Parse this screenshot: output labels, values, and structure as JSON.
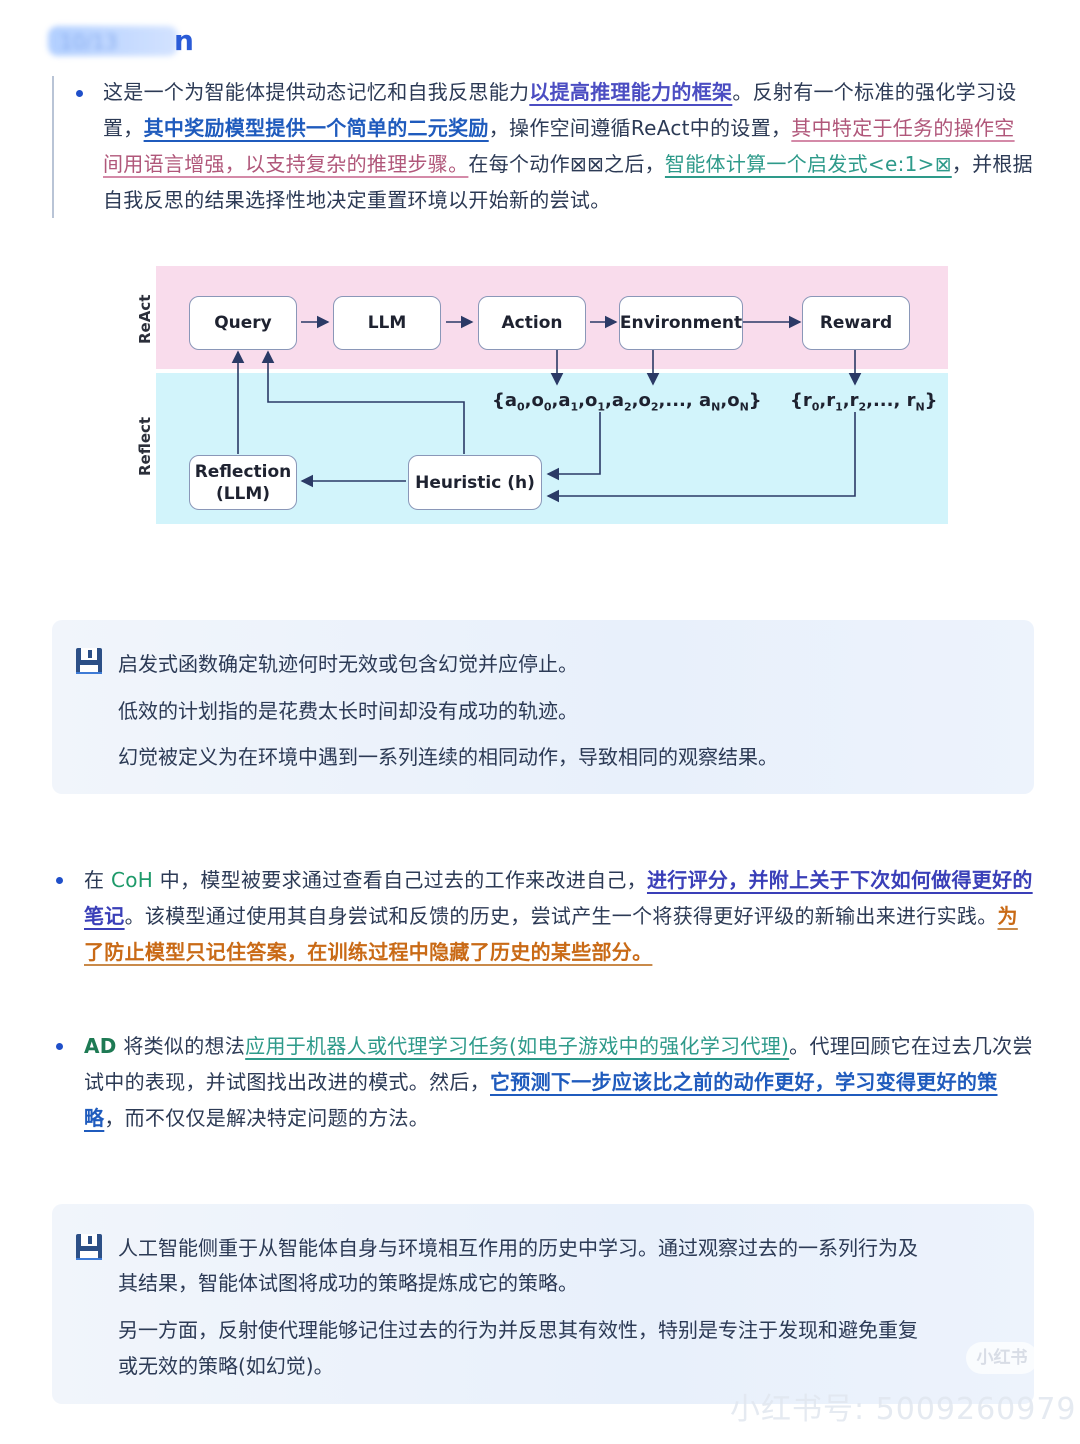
{
  "header": {
    "blurred_badge": "10/13",
    "title_fragment": "n"
  },
  "section1": {
    "segments": [
      {
        "t": "这是一个为智能体提供动态记忆和自我反思能力",
        "s": ""
      },
      {
        "t": "以提高推理能力的框架",
        "s": "u-purple"
      },
      {
        "t": "。反射有一个标准的强化学习设置，",
        "s": ""
      },
      {
        "t": "其中奖励模型提供一个简单的二元奖励",
        "s": "u-blue"
      },
      {
        "t": "，操作空间遵循ReAct中的设置，",
        "s": ""
      },
      {
        "t": "其中特定于任务的操作空间用语言增强，以支持复杂的推理步骤。",
        "s": "u-pink"
      },
      {
        "t": "在每个动作⊠⊠之后，",
        "s": ""
      },
      {
        "t": "智能体计算一个启发式<e:1>⊠",
        "s": "u-teal"
      },
      {
        "t": "，并根据自我反思的结果选择性地决定重置环境以开始新的尝试。",
        "s": ""
      }
    ]
  },
  "diagram": {
    "lanes": {
      "react": "ReAct",
      "reflect": "Reflect"
    },
    "nodes": {
      "query": "Query",
      "llm": "LLM",
      "action": "Action",
      "environment": "Environment",
      "reward": "Reward",
      "reflection_line1": "Reflection",
      "reflection_line2": "(LLM)",
      "heuristic": "Heuristic (h)"
    },
    "trajectory_seq": "{a0,o0,a1,o1,a2,o2,..., aN,oN}",
    "reward_seq": "{r0,r1,r2,..., rN}"
  },
  "callout1": {
    "icon": "save-icon",
    "lines": [
      "启发式函数确定轨迹何时无效或包含幻觉并应停止。",
      "低效的计划指的是花费太长时间却没有成功的轨迹。",
      "幻觉被定义为在环境中遇到一系列连续的相同动作，导致相同的观察结果。"
    ]
  },
  "section2": {
    "segments": [
      {
        "t": "在 ",
        "s": ""
      },
      {
        "t": "CoH",
        "s": "green"
      },
      {
        "t": " 中，模型被要求通过查看自己过去的工作来改进自己，",
        "s": ""
      },
      {
        "t": "进行评分，并附上关于下次如何做得更好的笔记",
        "s": "u-indigo"
      },
      {
        "t": "。该模型通过使用其自身尝试和反馈的历史，尝试产生一个将获得更好评级的新输出来进行实践。",
        "s": ""
      },
      {
        "t": "为了防止模型只记住答案，在训练过程中隐藏了历史的某些部分。",
        "s": "u-orange"
      }
    ]
  },
  "section3": {
    "segments": [
      {
        "t": " AD",
        "s": "green-b"
      },
      {
        "t": " 将类似的想法",
        "s": ""
      },
      {
        "t": "应用于机器人或代理学习任务(如电子游戏中的强化学习代理)",
        "s": "u-teal"
      },
      {
        "t": "。代理回顾它在过去几次尝试中的表现，并试图找出改进的模式。然后，",
        "s": ""
      },
      {
        "t": "它预测下一步应该比之前的动作更好，学习变得更好的策略",
        "s": "u-blue"
      },
      {
        "t": "，而不仅仅是解决特定问题的方法。",
        "s": ""
      }
    ]
  },
  "callout2": {
    "icon": "save-icon",
    "lines": [
      "人工智能侧重于从智能体自身与环境相互作用的历史中学习。通过观察过去的一系列行为及",
      "其结果，智能体试图将成功的策略提炼成它的策略。",
      "另一方面，反射使代理能够记住过去的行为并反思其有效性，特别是专注于发现和避免重复",
      "或无效的策略(如幻觉)。"
    ]
  },
  "watermark": {
    "logo": "小红书",
    "account": "小红书号: 5009260979"
  }
}
